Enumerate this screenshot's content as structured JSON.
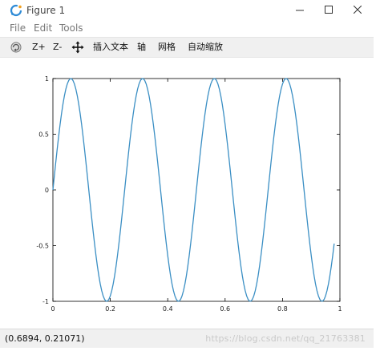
{
  "window": {
    "title": "Figure 1"
  },
  "menu": {
    "items": [
      "File",
      "Edit",
      "Tools"
    ]
  },
  "toolbar": {
    "rotate_icon": "rotate-3d-icon",
    "zoom_in_label": "Z+",
    "zoom_out_label": "Z-",
    "pan_icon": "pan-arrows-icon",
    "insert_text_label": "插入文本",
    "axis_label": "轴",
    "grid_label": "网格",
    "autoscale_label": "自动缩放"
  },
  "status": {
    "coordinates": "(0.6894, 0.21071)",
    "watermark": "https://blog.csdn.net/qq_21763381"
  },
  "colors": {
    "line": "#3b8fc4",
    "toolbar_bg": "#f0f0f0",
    "status_bg": "#f0f0f0"
  },
  "chart_data": {
    "type": "line",
    "function": "sin(2*pi*4*x)",
    "x_start": 0,
    "x_end": 0.98,
    "x_step": 0.005,
    "xlim": [
      0,
      1
    ],
    "ylim": [
      -1,
      1
    ],
    "x_ticks": [
      "0",
      "0.2",
      "0.4",
      "0.6",
      "0.8",
      "1"
    ],
    "y_ticks": [
      "1",
      "0.5",
      "0",
      "-0.5",
      "-1"
    ],
    "grid": false,
    "title": "",
    "xlabel": "",
    "ylabel": ""
  }
}
